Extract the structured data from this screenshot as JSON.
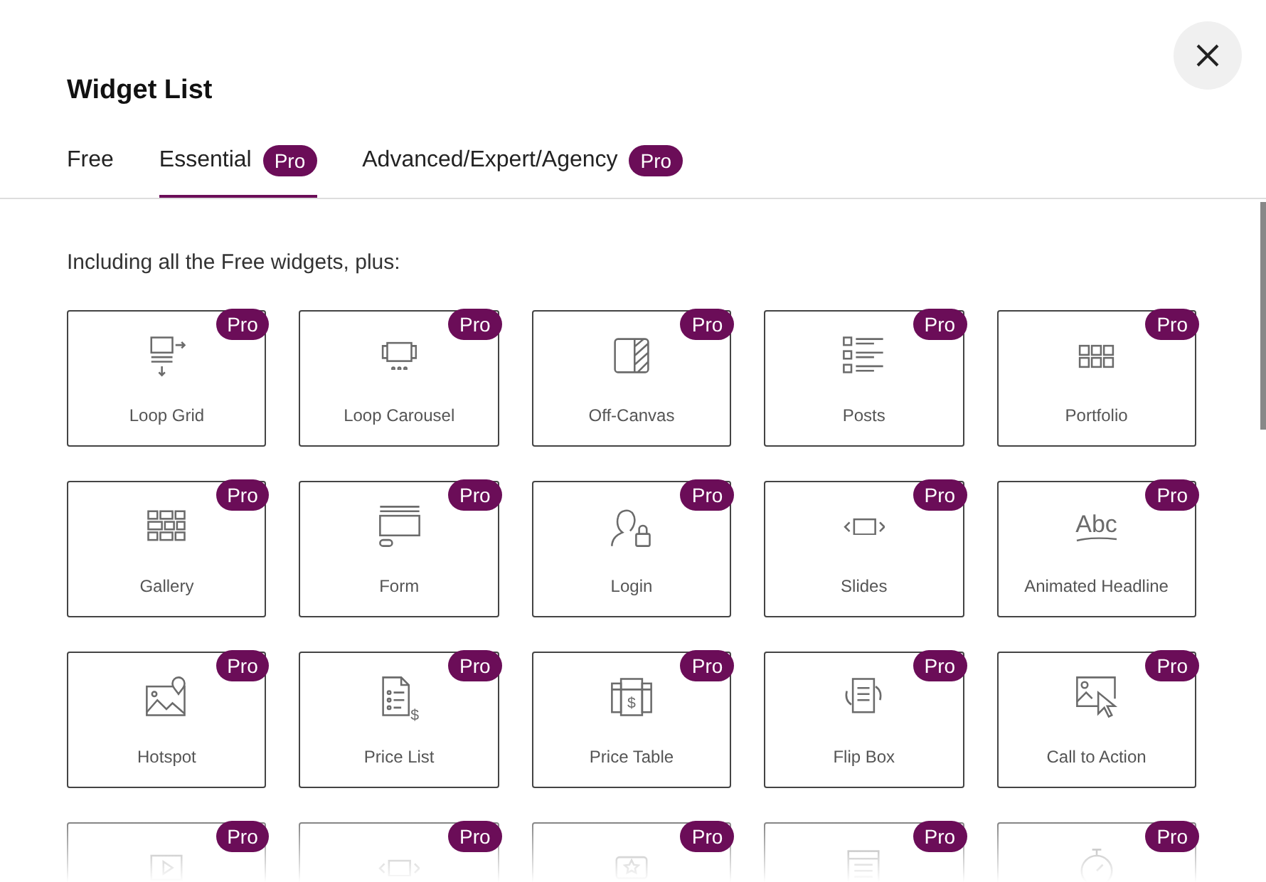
{
  "dialog": {
    "title": "Widget List"
  },
  "tabs": [
    {
      "label": "Free",
      "selected": false
    },
    {
      "label": "Essential",
      "badge": "Pro",
      "selected": true
    },
    {
      "label": "Advanced/Expert/Agency",
      "badge": "Pro",
      "selected": false
    }
  ],
  "intro": "Including all the Free widgets, plus:",
  "widgets": [
    {
      "label": "Loop Grid",
      "kind": "loop-grid",
      "badge": "Pro"
    },
    {
      "label": "Loop Carousel",
      "kind": "carousel",
      "badge": "Pro"
    },
    {
      "label": "Off-Canvas",
      "kind": "off-canvas",
      "badge": "Pro"
    },
    {
      "label": "Posts",
      "kind": "posts",
      "badge": "Pro"
    },
    {
      "label": "Portfolio",
      "kind": "portfolio",
      "badge": "Pro"
    },
    {
      "label": "Gallery",
      "kind": "gallery",
      "badge": "Pro"
    },
    {
      "label": "Form",
      "kind": "form",
      "badge": "Pro"
    },
    {
      "label": "Login",
      "kind": "login",
      "badge": "Pro"
    },
    {
      "label": "Slides",
      "kind": "slides",
      "badge": "Pro"
    },
    {
      "label": "Animated Headline",
      "kind": "headline",
      "icon_text": "Abc",
      "badge": "Pro"
    },
    {
      "label": "Hotspot",
      "kind": "hotspot",
      "badge": "Pro"
    },
    {
      "label": "Price List",
      "kind": "price-list",
      "icon_text": "$",
      "badge": "Pro"
    },
    {
      "label": "Price Table",
      "kind": "price-table",
      "icon_text": "$",
      "badge": "Pro"
    },
    {
      "label": "Flip Box",
      "kind": "flip-box",
      "badge": "Pro"
    },
    {
      "label": "Call to Action",
      "kind": "cta",
      "badge": "Pro"
    },
    {
      "kind": "video",
      "badge": "Pro"
    },
    {
      "kind": "slides",
      "badge": "Pro"
    },
    {
      "kind": "rating",
      "badge": "Pro"
    },
    {
      "kind": "table",
      "badge": "Pro"
    },
    {
      "kind": "timer",
      "badge": "Pro"
    }
  ]
}
